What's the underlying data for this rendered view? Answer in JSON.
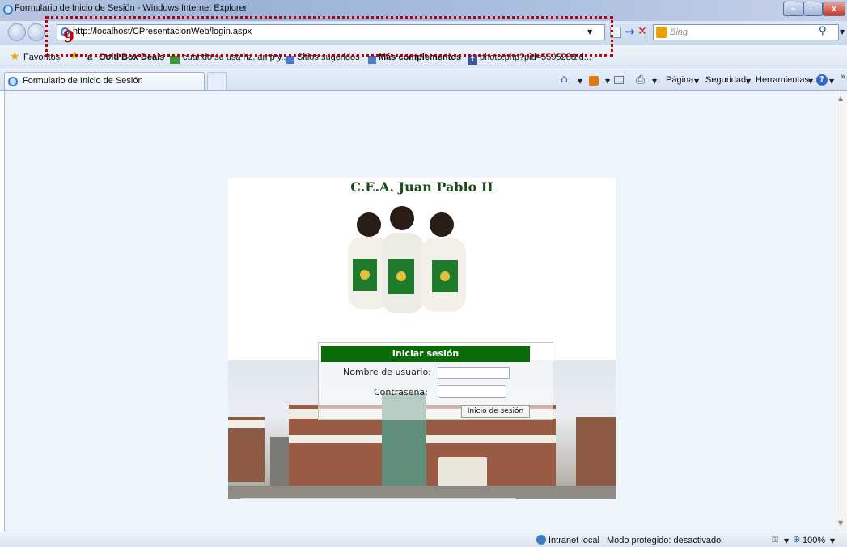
{
  "window": {
    "title": "Formulario de Inicio de Sesión - Windows Internet Explorer",
    "buttons": [
      "–",
      "□",
      "x"
    ]
  },
  "navbar": {
    "url": "http://localhost/CPresentacionWeb/login.aspx",
    "search_placeholder": "Bing"
  },
  "favorites": {
    "label": "Favoritos",
    "items": [
      "Gold Box Deals",
      "cuando se usa hz. amp y...",
      "Sitios sugeridos",
      "Más complementos",
      "photo.php?pid=559528&id..."
    ]
  },
  "tabs": {
    "active": "Formulario de Inicio de Sesión"
  },
  "commandbar": {
    "page": "Página",
    "security": "Seguridad",
    "tools": "Herramientas"
  },
  "page": {
    "school_name": "C.E.A. Juan Pablo II",
    "login": {
      "header": "Iniciar sesión",
      "username_label": "Nombre de usuario:",
      "password_label": "Contraseña:",
      "submit": "Inicio de sesión"
    }
  },
  "statusbar": {
    "zone": "Intranet local | Modo protegido: desactivado",
    "zoom": "100%"
  },
  "annotation": {
    "number": "9"
  },
  "colors": {
    "login_header": "#0b6b0b",
    "school_title": "#1b4a1b",
    "annotation": "#c00000"
  }
}
